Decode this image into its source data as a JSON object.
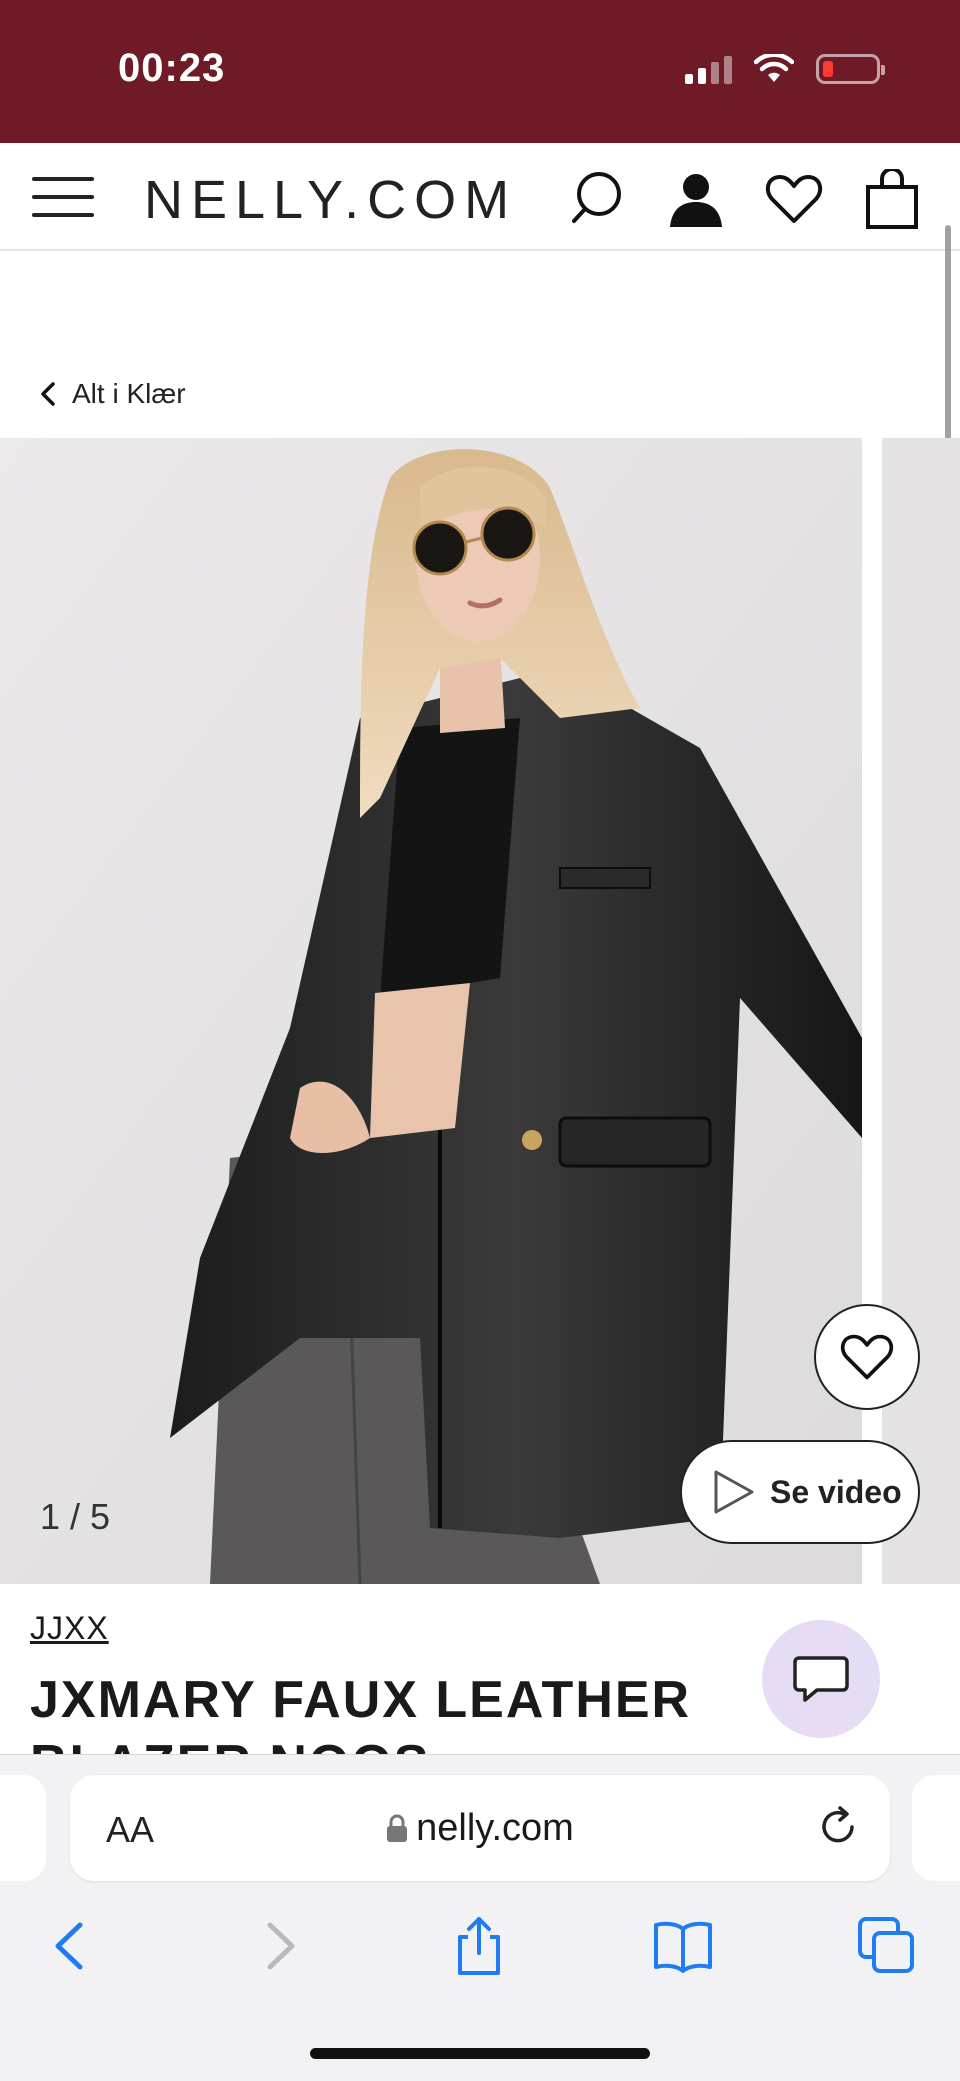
{
  "status_bar": {
    "time": "00:23"
  },
  "header": {
    "logo": "NELLY.COM",
    "icons": [
      "menu-icon",
      "search-icon",
      "account-icon",
      "wishlist-icon",
      "bag-icon"
    ]
  },
  "breadcrumb": {
    "label": "Alt i Klær"
  },
  "gallery": {
    "counter": "1 / 5",
    "video_label": "Se video"
  },
  "product": {
    "brand": "JJXX",
    "title": "JXMARY FAUX LEATHER BLAZER NOOS"
  },
  "browser": {
    "text_size_label": "AA",
    "url": "nelly.com"
  },
  "colors": {
    "status_bar": "#6e1a27",
    "chat_button": "#e6dcf3",
    "ios_blue": "#1f7cf2"
  }
}
